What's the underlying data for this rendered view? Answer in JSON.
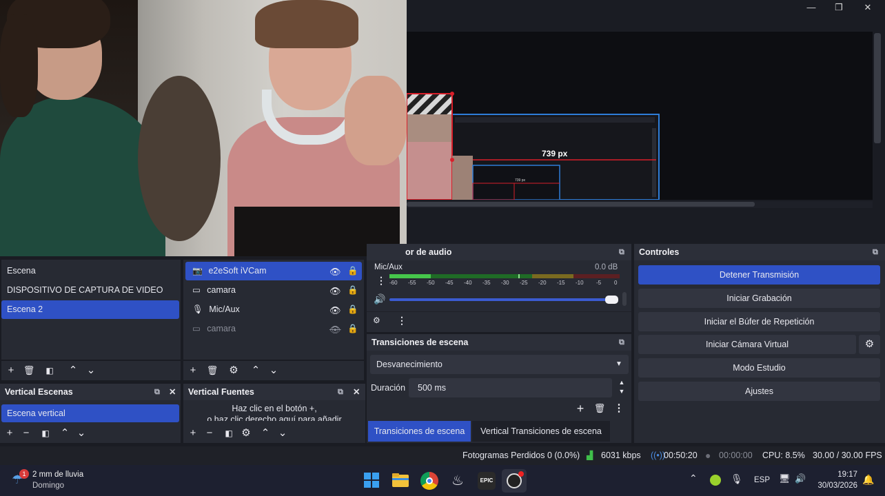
{
  "preview": {
    "measure_label": "739 px",
    "inner_measure_label": "739 px"
  },
  "audio_mixer": {
    "header": "or de audio",
    "channel_name": "Mic/Aux",
    "level_db": "0.0 dB",
    "ticks": [
      "-60",
      "-55",
      "-50",
      "-45",
      "-40",
      "-35",
      "-30",
      "-25",
      "-20",
      "-15",
      "-10",
      "-5",
      "0"
    ],
    "volume_fraction": 1.0
  },
  "scenes": {
    "items": [
      "Escena",
      "DISPOSITIVO DE CAPTURA DE VIDEO",
      "Escena 2"
    ],
    "selected_index": 2
  },
  "sources": {
    "items": [
      {
        "label": "e2eSoft iVCam",
        "icon": "camera-icon",
        "visible": true
      },
      {
        "label": "camara",
        "icon": "monitor-icon",
        "visible": true
      },
      {
        "label": "Mic/Aux",
        "icon": "microphone-icon",
        "visible": true
      },
      {
        "label": "camara",
        "icon": "monitor-icon",
        "visible": false
      }
    ]
  },
  "vertical_scenes": {
    "header": "Vertical Escenas",
    "items": [
      "Escena vertical"
    ]
  },
  "vertical_sources": {
    "header": "Vertical Fuentes",
    "hint_line1": "Haz clic en el botón +,",
    "hint_line2": "o haz clic derecho aquí para añadir"
  },
  "transitions": {
    "header": "Transiciones de escena",
    "selected": "Desvanecimiento",
    "duration_label": "Duración",
    "duration_value": "500 ms",
    "tabs": [
      "Transiciones de escena",
      "Vertical Transiciones de escena"
    ]
  },
  "controls": {
    "header": "Controles",
    "buttons": [
      "Detener Transmisión",
      "Iniciar Grabación",
      "Iniciar el Búfer de Repetición",
      "Iniciar Cámara Virtual",
      "Modo Estudio",
      "Ajustes"
    ]
  },
  "status": {
    "dropped": "Fotogramas Perdidos 0 (0.0%)",
    "bitrate": "6031 kbps",
    "stream_time": "00:50:20",
    "rec_time": "00:00:00",
    "cpu": "CPU: 8.5%",
    "fps": "30.00 / 30.00 FPS"
  },
  "taskbar": {
    "weather_title": "2 mm de lluvia",
    "weather_sub": "Domingo",
    "weather_badge": "1",
    "lang": "ESP",
    "time": "19:17",
    "date": "30/03/2026"
  },
  "colors": {
    "accent": "#2f51c5",
    "panel": "#272a33",
    "selection_red": "#d81f2a",
    "selection_blue": "#2e7dd8"
  }
}
